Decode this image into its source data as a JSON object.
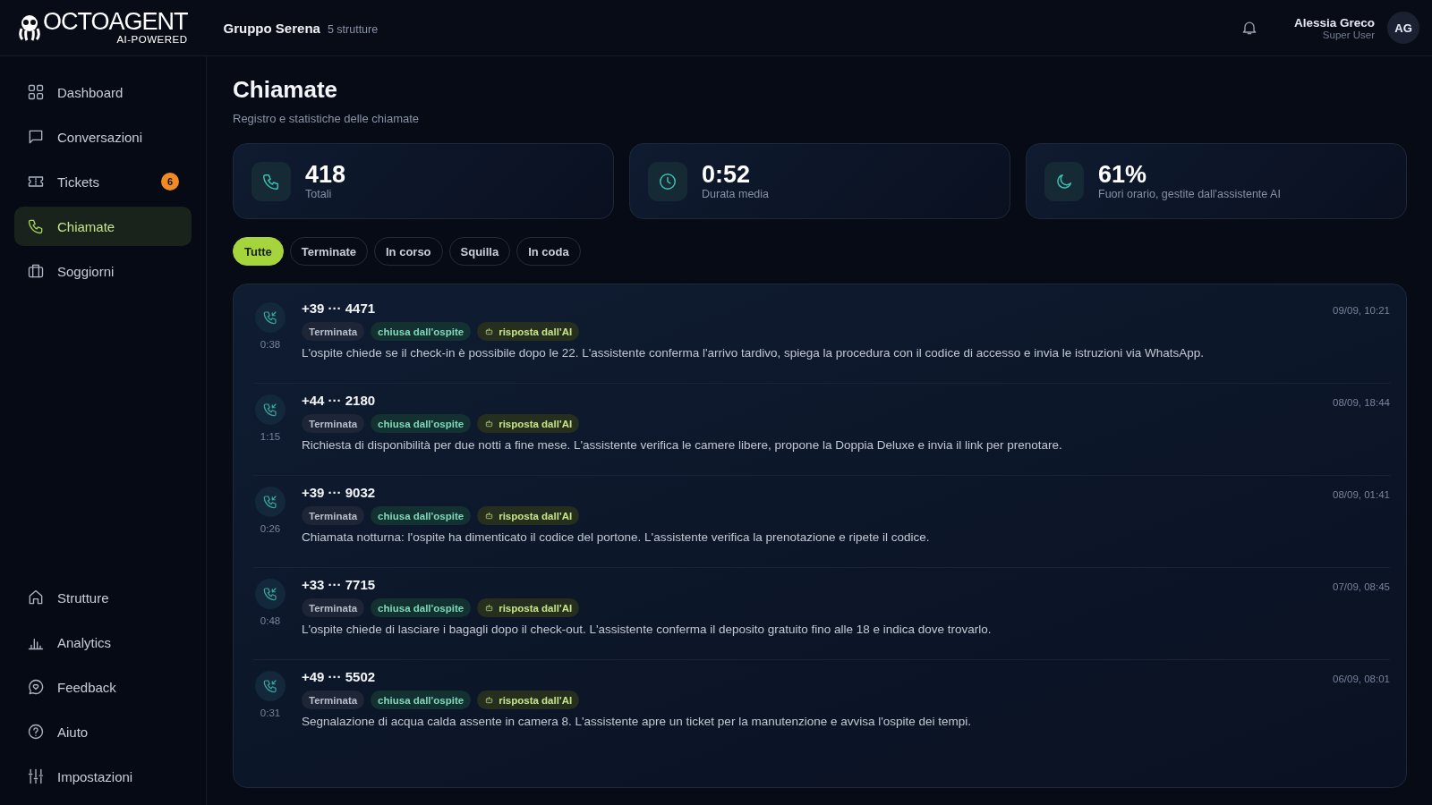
{
  "logo": {
    "name": "OCTOAGENT",
    "tagline": "AI-POWERED"
  },
  "org": {
    "name": "Gruppo Serena",
    "count": "5 strutture"
  },
  "user": {
    "name": "Alessia Greco",
    "role": "Super User",
    "initials": "AG"
  },
  "sidebar": {
    "items": [
      {
        "label": "Dashboard",
        "selected": false
      },
      {
        "label": "Conversazioni",
        "selected": false
      },
      {
        "label": "Tickets",
        "selected": false,
        "badge": "6"
      },
      {
        "label": "Chiamate",
        "selected": true
      },
      {
        "label": "Soggiorni",
        "selected": false
      }
    ],
    "bottom_items": [
      {
        "label": "Strutture",
        "selected": false
      },
      {
        "label": "Analytics",
        "selected": false
      },
      {
        "label": "Feedback",
        "selected": false
      },
      {
        "label": "Aiuto",
        "selected": false
      },
      {
        "label": "Impostazioni",
        "selected": false
      }
    ]
  },
  "page": {
    "title": "Chiamate",
    "subtitle": "Registro e statistiche delle chiamate"
  },
  "stats": [
    {
      "value": "418",
      "label": "Totali"
    },
    {
      "value": "0:52",
      "label": "Durata media"
    },
    {
      "value": "61%",
      "label": "Fuori orario, gestite dall'assistente AI"
    }
  ],
  "filters": [
    {
      "label": "Tutte",
      "selected": true
    },
    {
      "label": "Terminate",
      "selected": false
    },
    {
      "label": "In corso",
      "selected": false
    },
    {
      "label": "Squilla",
      "selected": false
    },
    {
      "label": "In coda",
      "selected": false
    }
  ],
  "calls": [
    {
      "number": "+39 ··· 4471",
      "duration": "0:38",
      "time": "09/09, 10:21",
      "tags": [
        {
          "kind": "status",
          "label": "Terminata"
        },
        {
          "kind": "closed",
          "label": "chiusa dall'ospite"
        },
        {
          "kind": "ai",
          "label": "risposta dall'AI"
        }
      ],
      "summary": "L'ospite chiede se il check-in è possibile dopo le 22. L'assistente conferma l'arrivo tardivo, spiega la procedura con il codice di accesso e invia le istruzioni via WhatsApp."
    },
    {
      "number": "+44 ··· 2180",
      "duration": "1:15",
      "time": "08/09, 18:44",
      "tags": [
        {
          "kind": "status",
          "label": "Terminata"
        },
        {
          "kind": "closed",
          "label": "chiusa dall'ospite"
        },
        {
          "kind": "ai",
          "label": "risposta dall'AI"
        }
      ],
      "summary": "Richiesta di disponibilità per due notti a fine mese. L'assistente verifica le camere libere, propone la Doppia Deluxe e invia il link per prenotare."
    },
    {
      "number": "+39 ··· 9032",
      "duration": "0:26",
      "time": "08/09, 01:41",
      "tags": [
        {
          "kind": "status",
          "label": "Terminata"
        },
        {
          "kind": "closed",
          "label": "chiusa dall'ospite"
        },
        {
          "kind": "ai",
          "label": "risposta dall'AI"
        }
      ],
      "summary": "Chiamata notturna: l'ospite ha dimenticato il codice del portone. L'assistente verifica la prenotazione e ripete il codice."
    },
    {
      "number": "+33 ··· 7715",
      "duration": "0:48",
      "time": "07/09, 08:45",
      "tags": [
        {
          "kind": "status",
          "label": "Terminata"
        },
        {
          "kind": "closed",
          "label": "chiusa dall'ospite"
        },
        {
          "kind": "ai",
          "label": "risposta dall'AI"
        }
      ],
      "summary": "L'ospite chiede di lasciare i bagagli dopo il check-out. L'assistente conferma il deposito gratuito fino alle 18 e indica dove trovarlo."
    },
    {
      "number": "+49 ··· 5502",
      "duration": "0:31",
      "time": "06/09, 08:01",
      "tags": [
        {
          "kind": "status",
          "label": "Terminata"
        },
        {
          "kind": "closed",
          "label": "chiusa dall'ospite"
        },
        {
          "kind": "ai",
          "label": "risposta dall'AI"
        }
      ],
      "summary": "Segnalazione di acqua calda assente in camera 8. L'assistente apre un ticket per la manutenzione e avvisa l'ospite dei tempi."
    }
  ]
}
